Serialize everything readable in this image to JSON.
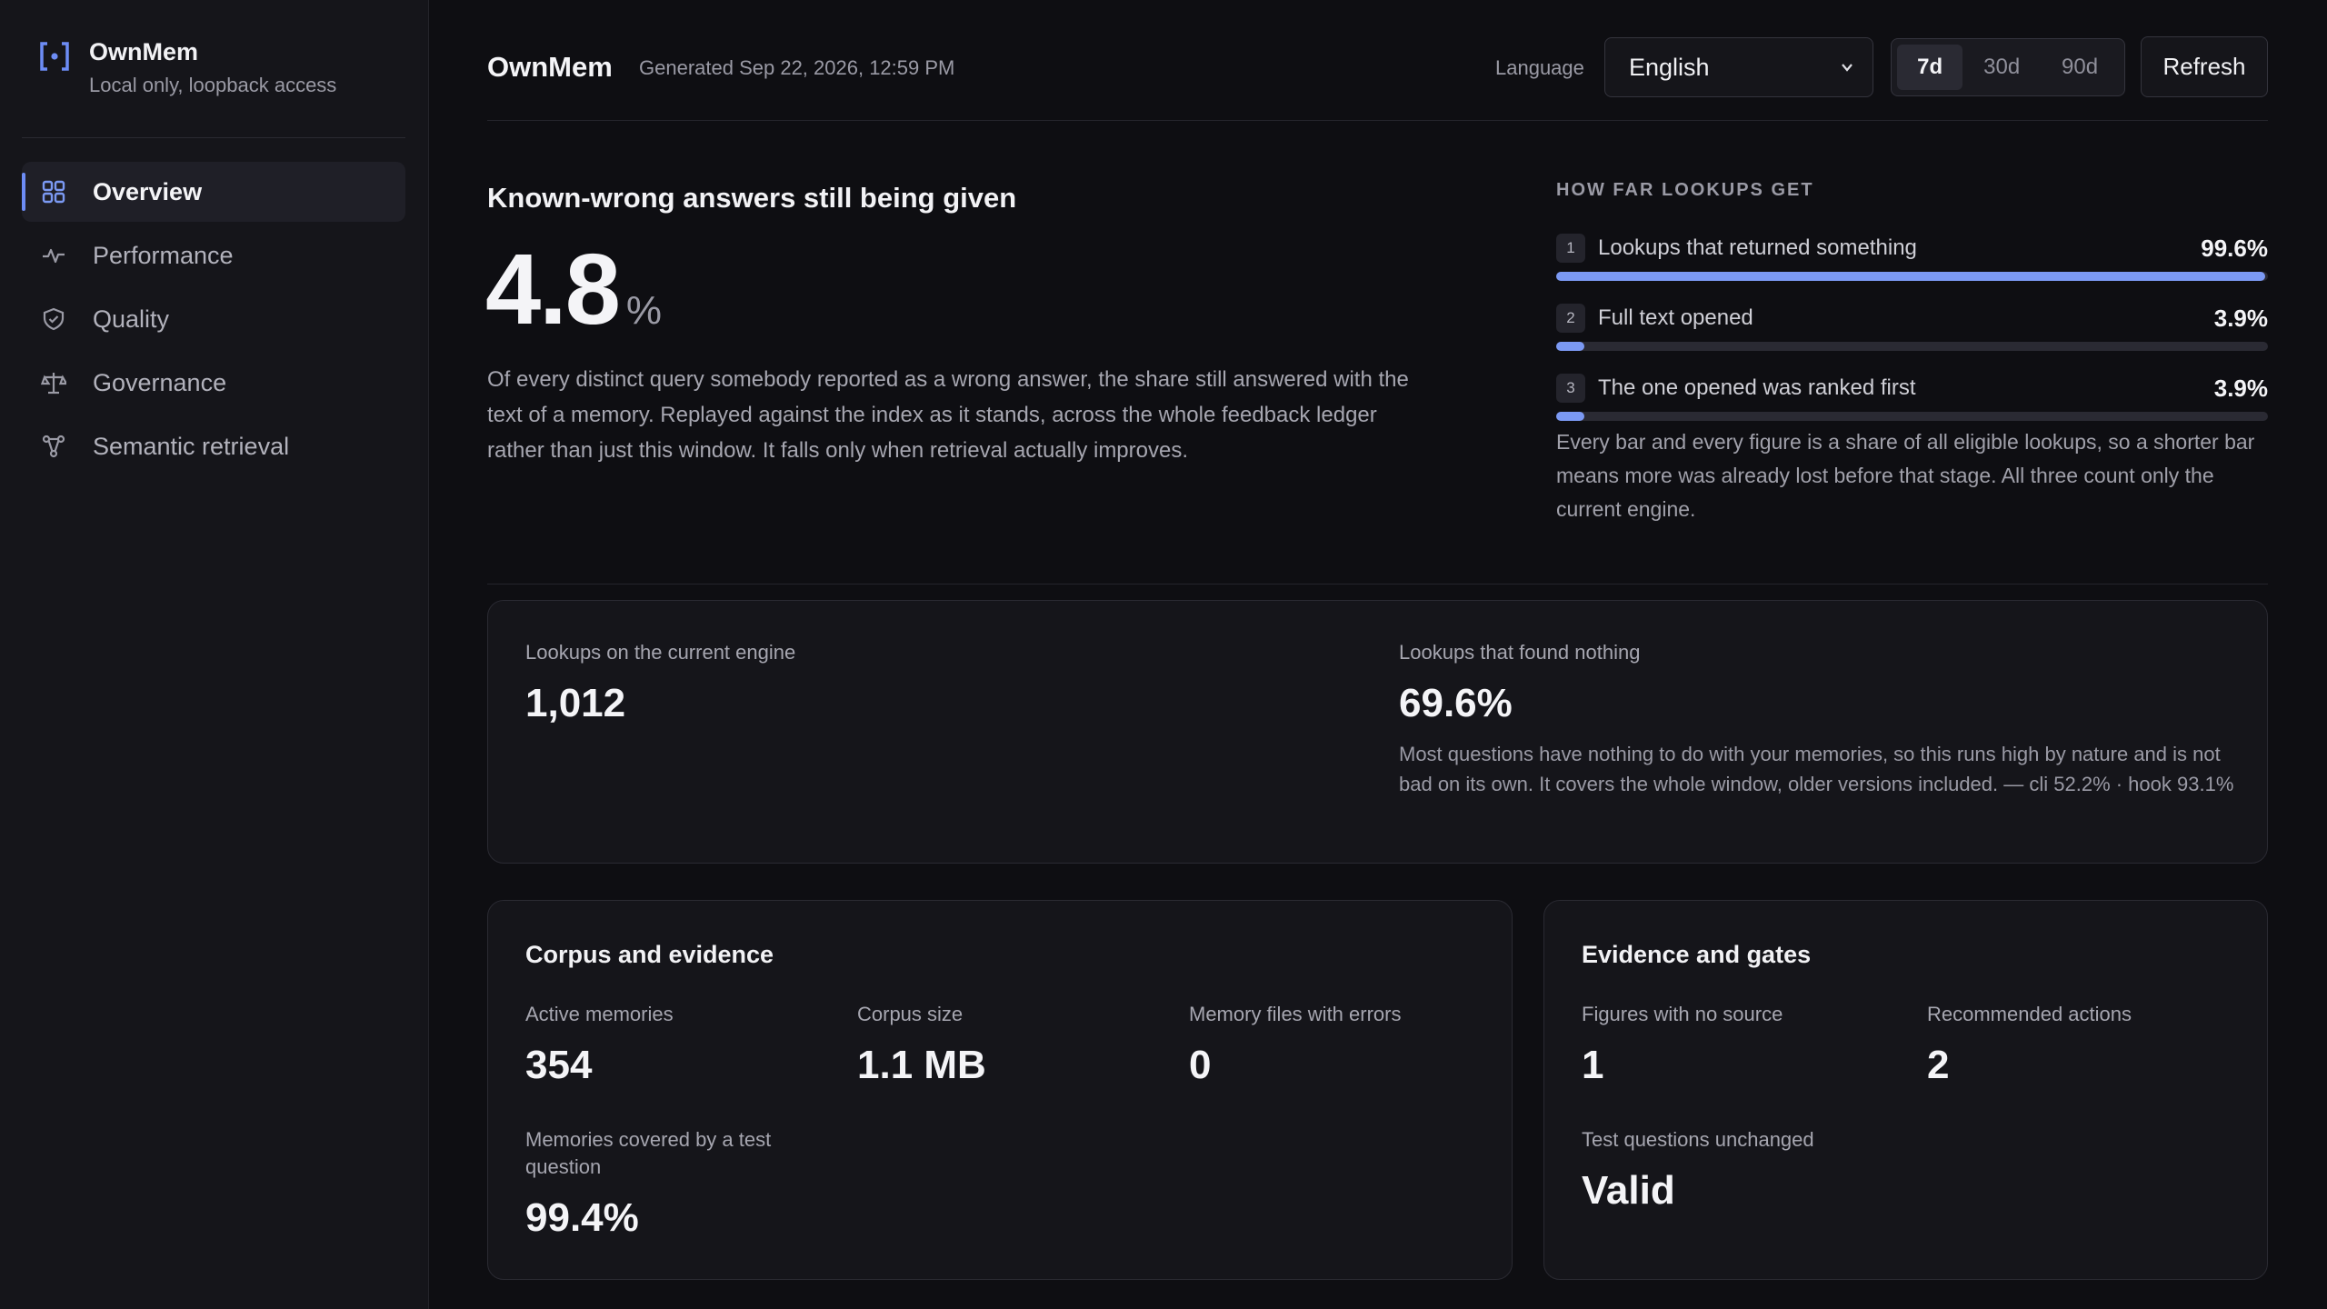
{
  "app": {
    "name": "OwnMem",
    "subtitle": "Local only, loopback access"
  },
  "sidebar": {
    "items": [
      {
        "label": "Overview",
        "icon": "grid-icon",
        "active": true
      },
      {
        "label": "Performance",
        "icon": "pulse-icon",
        "active": false
      },
      {
        "label": "Quality",
        "icon": "shield-check-icon",
        "active": false
      },
      {
        "label": "Governance",
        "icon": "scales-icon",
        "active": false
      },
      {
        "label": "Semantic retrieval",
        "icon": "network-icon",
        "active": false
      }
    ]
  },
  "header": {
    "title": "OwnMem",
    "generated": "Generated Sep 22, 2026, 12:59 PM",
    "language_label": "Language",
    "language_value": "English",
    "ranges": [
      "7d",
      "30d",
      "90d"
    ],
    "selected_range": "7d",
    "refresh_label": "Refresh"
  },
  "hero": {
    "title": "Known-wrong answers still being given",
    "value": "4.8",
    "unit": "%",
    "description": "Of every distinct query somebody reported as a wrong answer, the share still answered with the text of a memory. Replayed against the index as it stands, across the whole feedback ledger rather than just this window. It falls only when retrieval actually improves."
  },
  "funnel": {
    "heading": "HOW FAR LOOKUPS GET",
    "steps": [
      {
        "num": "1",
        "label": "Lookups that returned something",
        "value": "99.6%",
        "fraction": 0.996
      },
      {
        "num": "2",
        "label": "Full text opened",
        "value": "3.9%",
        "fraction": 0.039
      },
      {
        "num": "3",
        "label": "The one opened was ranked first",
        "value": "3.9%",
        "fraction": 0.039
      }
    ],
    "note": "Every bar and every figure is a share of all eligible lookups, so a shorter bar means more was already lost before that stage. All three count only the current engine."
  },
  "lookups_card": {
    "current_label": "Lookups on the current engine",
    "current_value": "1,012",
    "nothing_label": "Lookups that found nothing",
    "nothing_value": "69.6%",
    "nothing_note": "Most questions have nothing to do with your memories, so this runs high by nature and is not bad on its own. It covers the whole window, older versions included. — cli 52.2% · hook 93.1%"
  },
  "corpus": {
    "title": "Corpus and evidence",
    "active_label": "Active memories",
    "active_value": "354",
    "size_label": "Corpus size",
    "size_value": "1.1 MB",
    "errors_label": "Memory files with errors",
    "errors_value": "0",
    "covered_label": "Memories covered by a test question",
    "covered_value": "99.4%"
  },
  "gates": {
    "title": "Evidence and gates",
    "nosource_label": "Figures with no source",
    "nosource_value": "1",
    "actions_label": "Recommended actions",
    "actions_value": "2",
    "unchanged_label": "Test questions unchanged",
    "unchanged_value": "Valid"
  },
  "colors": {
    "accent": "#7b99f3",
    "background": "#0e0e12",
    "sidebar": "#15151a"
  }
}
